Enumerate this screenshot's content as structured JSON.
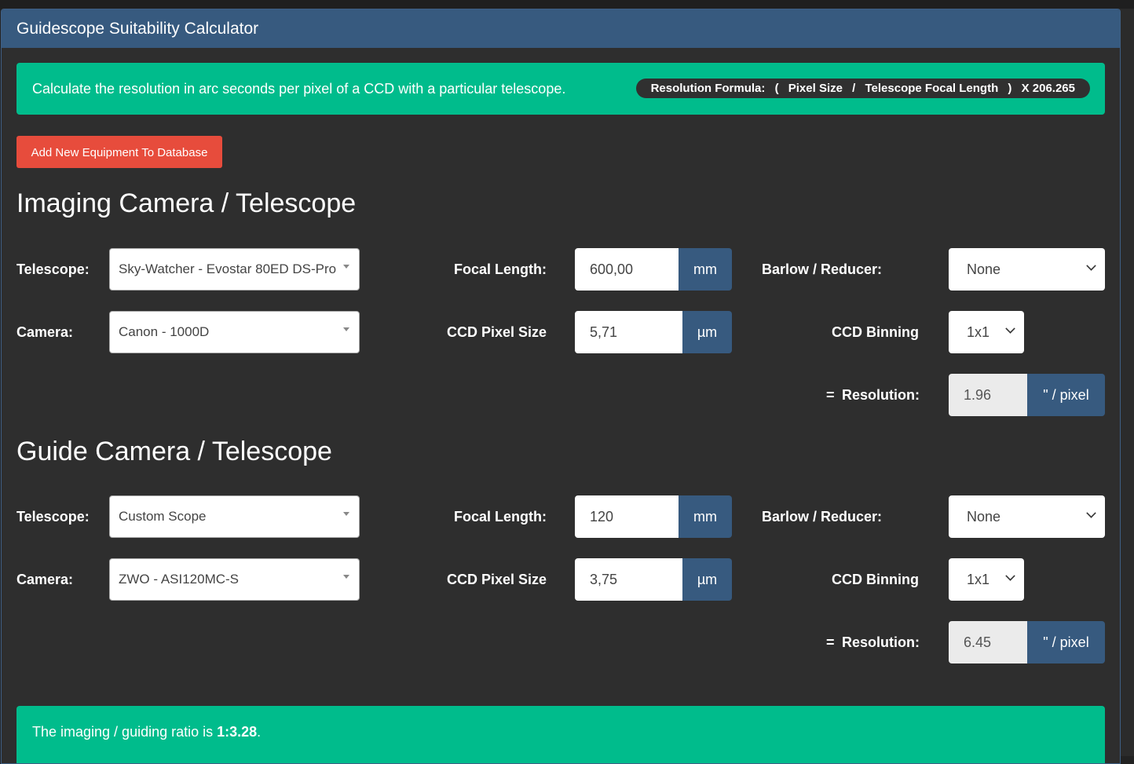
{
  "panel": {
    "title": "Guidescope Suitability Calculator"
  },
  "info": {
    "description": "Calculate the resolution in arc seconds per pixel of a CCD with a particular telescope.",
    "formula": {
      "label": "Resolution Formula:",
      "open": "(",
      "term1": "Pixel Size",
      "divider": "/",
      "term2": "Telescope Focal Length",
      "close": ")",
      "multiplier": "X 206.265"
    }
  },
  "add_button": "Add New Equipment To Database",
  "imaging": {
    "title": "Imaging Camera / Telescope",
    "telescope_label": "Telescope:",
    "telescope_value": "Sky-Watcher - Evostar 80ED DS-Pro",
    "camera_label": "Camera:",
    "camera_value": "Canon - 1000D",
    "focal_label": "Focal Length:",
    "focal_value": "600,00",
    "focal_unit": "mm",
    "pixel_label": "CCD Pixel Size",
    "pixel_value": "5,71",
    "pixel_unit": "µm",
    "barlow_label": "Barlow / Reducer:",
    "barlow_value": "None",
    "binning_label": "CCD Binning",
    "binning_value": "1x1",
    "eq": "=",
    "resolution_label": "Resolution:",
    "resolution_value": "1.96",
    "resolution_unit": "\" / pixel"
  },
  "guide": {
    "title": "Guide Camera / Telescope",
    "telescope_label": "Telescope:",
    "telescope_value": "Custom Scope",
    "camera_label": "Camera:",
    "camera_value": "ZWO - ASI120MC-S",
    "focal_label": "Focal Length:",
    "focal_value": "120",
    "focal_unit": "mm",
    "pixel_label": "CCD Pixel Size",
    "pixel_value": "3,75",
    "pixel_unit": "µm",
    "barlow_label": "Barlow / Reducer:",
    "barlow_value": "None",
    "binning_label": "CCD Binning",
    "binning_value": "1x1",
    "eq": "=",
    "resolution_label": "Resolution:",
    "resolution_value": "6.45",
    "resolution_unit": "\" / pixel"
  },
  "result": {
    "prefix": "The imaging / guiding ratio is ",
    "ratio": "1:3.28",
    "suffix": "."
  },
  "colors": {
    "header": "#375a7f",
    "success": "#00bc8c",
    "danger": "#e74c3c",
    "panel_bg": "#2e2e2e"
  }
}
